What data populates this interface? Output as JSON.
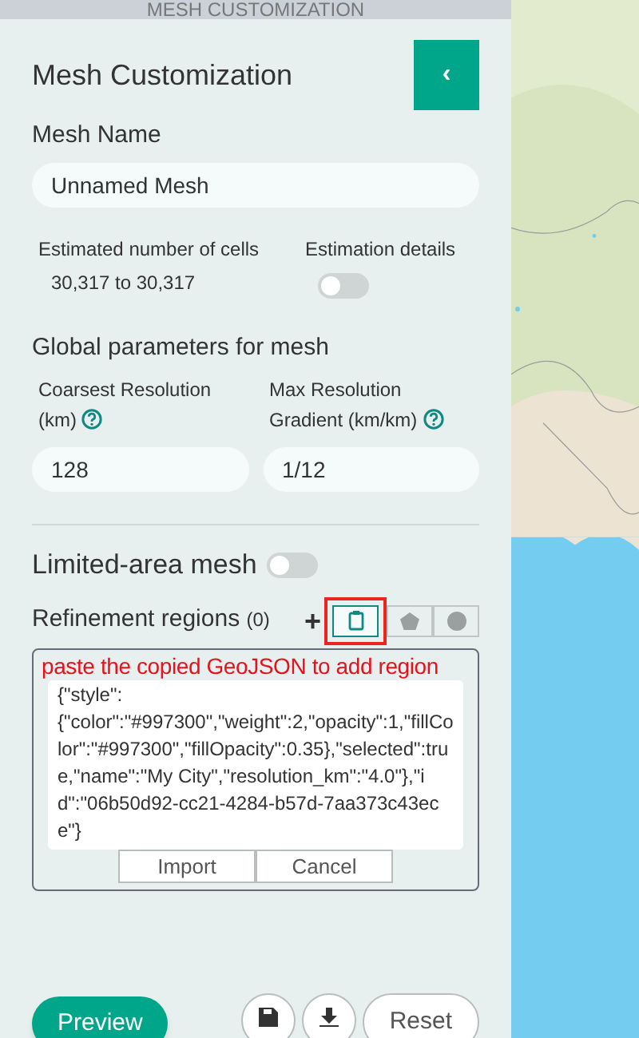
{
  "top_bar": {
    "title": "MESH CUSTOMIZATION"
  },
  "panel": {
    "title": "Mesh Customization",
    "collapse_icon": "‹"
  },
  "mesh_name": {
    "label": "Mesh Name",
    "value": "Unnamed Mesh"
  },
  "estimate": {
    "label": "Estimated number of cells",
    "value": "30,317 to 30,317"
  },
  "estimation_details": {
    "label": "Estimation details",
    "on": false
  },
  "global_params": {
    "heading": "Global parameters for mesh",
    "fields": [
      {
        "label": "Coarsest Resolution (km)",
        "value": "128"
      },
      {
        "label": "Max Resolution Gradient (km/km)",
        "value": "1/12"
      }
    ]
  },
  "limited_area": {
    "label": "Limited-area mesh",
    "on": false
  },
  "refinement": {
    "label": "Refinement regions",
    "count": "(0)",
    "add": "+",
    "tools": [
      {
        "kind": "paste",
        "selected": true
      },
      {
        "kind": "polygon",
        "selected": false
      },
      {
        "kind": "circle",
        "selected": false
      }
    ],
    "annotation": "paste the copied GeoJSON to add region",
    "geojson": "{\"style\":\n{\"color\":\"#997300\",\"weight\":2,\"opacity\":1,\"fillColor\":\"#997300\",\"fillOpacity\":0.35},\"selected\":true,\"name\":\"My City\",\"resolution_km\":\"4.0\"},\"id\":\"06b50d92-cc21-4284-b57d-7aa373c43ece\"}",
    "buttons": [
      "Import",
      "Cancel"
    ]
  },
  "footer": {
    "preview": "Preview",
    "reset": "Reset"
  }
}
